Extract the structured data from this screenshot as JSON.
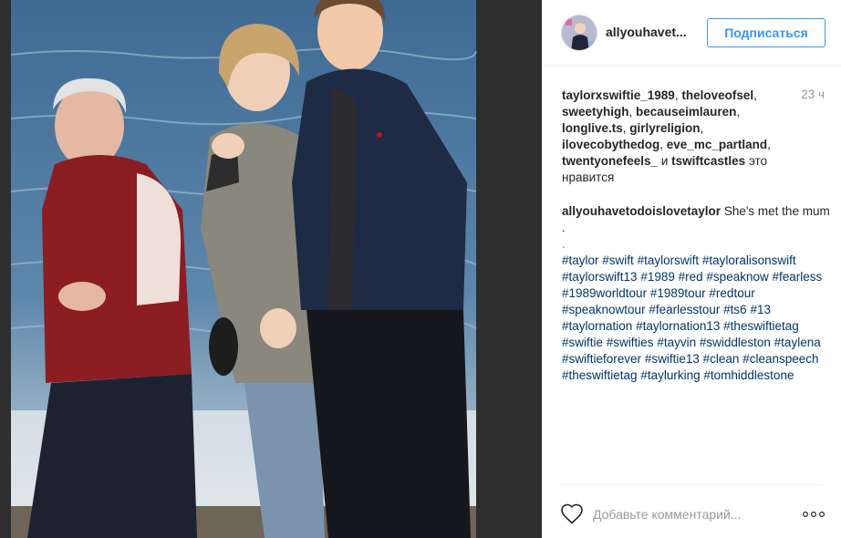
{
  "post": {
    "username": "allyouhavet...",
    "follow_label": "Подписаться",
    "timestamp": "23 ч",
    "likes": {
      "users": [
        "taylorxswiftie_1989",
        "theloveofsel",
        "sweetyhigh",
        "becauseimlauren",
        "longlive.ts",
        "girlyreligion",
        "ilovecobythedog",
        "eve_mc_partland",
        "twentyonefeels_",
        "tswiftcastles"
      ],
      "and_word": "и",
      "suffix": "это нравится"
    },
    "caption": {
      "author": "allyouhavetodoislovetaylor",
      "text": "She's met the mum .",
      "dot": ".",
      "hashtags": [
        "#taylor",
        "#swift",
        "#taylorswift",
        "#tayloralisonswift",
        "#taylorswift13",
        "#1989",
        "#red",
        "#speaknow",
        "#fearless",
        "#1989worldtour",
        "#1989tour",
        "#redtour",
        "#speaknowtour",
        "#fearlesstour",
        "#ts6",
        "#13",
        "#taylornation",
        "#taylornation13",
        "#theswiftietag",
        "#swiftie",
        "#swifties",
        "#tayvin",
        "#swiddleston",
        "#taylena",
        "#swiftieforever",
        "#swiftie13",
        "#clean",
        "#cleanspeech",
        "#theswiftietag",
        "#taylurking",
        "#tomhiddlestone"
      ]
    },
    "comment_placeholder": "Добавьте комментарий...",
    "icons": {
      "like": "heart-icon",
      "more": "more-options-icon"
    },
    "colors": {
      "follow": "#3897f0",
      "hashtag": "#003569",
      "panel_bg": "#ffffff",
      "backdrop": "#262626"
    }
  }
}
